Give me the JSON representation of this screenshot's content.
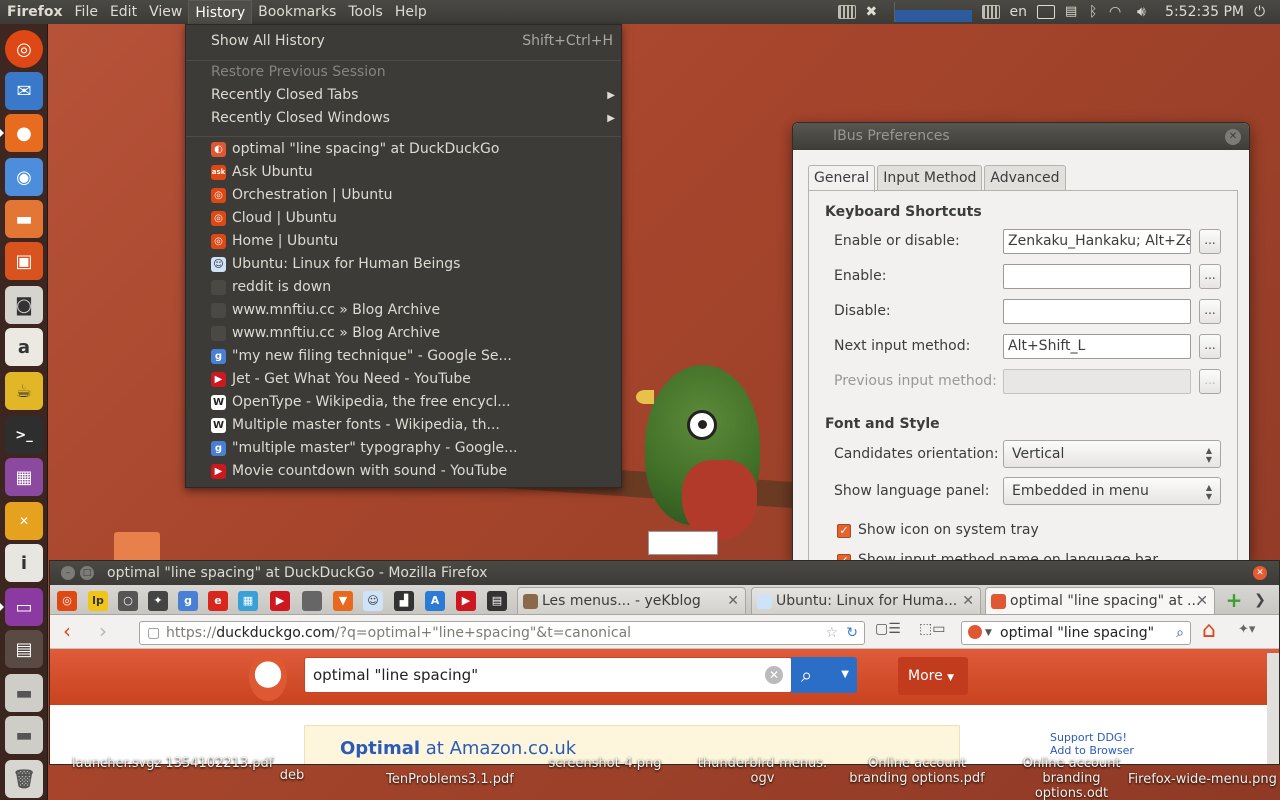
{
  "top_panel": {
    "app_name": "Firefox",
    "menus": [
      "File",
      "Edit",
      "View",
      "History",
      "Bookmarks",
      "Tools",
      "Help"
    ],
    "open_menu": "History",
    "tray": {
      "keyboard_layout": "en",
      "clock": "5:52:35 PM"
    }
  },
  "launcher": {
    "items": [
      "ubuntu-icon",
      "thunderbird-icon",
      "firefox-icon",
      "chromium-icon",
      "files-icon",
      "software-center-icon",
      "camera-icon",
      "font-icon",
      "teapot-icon",
      "terminal-icon",
      "video-editor-icon",
      "chat-icon",
      "info-icon",
      "monitor-icon",
      "window-icon",
      "drive-icon",
      "drive-icon-2",
      "trash-icon"
    ]
  },
  "history_menu": {
    "show_all": "Show All History",
    "show_all_accel": "Shift+Ctrl+H",
    "restore_session": "Restore Previous Session",
    "recently_closed_tabs": "Recently Closed Tabs",
    "recently_closed_windows": "Recently Closed Windows",
    "entries": [
      {
        "label": "optimal \"line spacing\" at DuckDuckGo",
        "icon": "duckduckgo-icon",
        "color": "#de5833"
      },
      {
        "label": "Ask Ubuntu",
        "icon": "askubuntu-icon",
        "color": "#dd4814"
      },
      {
        "label": "Orchestration | Ubuntu",
        "icon": "ubuntu-icon",
        "color": "#dd4814"
      },
      {
        "label": "Cloud | Ubuntu",
        "icon": "ubuntu-icon",
        "color": "#dd4814"
      },
      {
        "label": "Home | Ubuntu",
        "icon": "ubuntu-icon",
        "color": "#dd4814"
      },
      {
        "label": "Ubuntu: Linux for Human Beings",
        "icon": "reddit-icon",
        "color": "#cee3f8"
      },
      {
        "label": "reddit is down",
        "icon": "blank-page-icon",
        "color": "#4a4944"
      },
      {
        "label": "www.mnftiu.cc » Blog Archive",
        "icon": "blank-page-icon",
        "color": "#4a4944"
      },
      {
        "label": "www.mnftiu.cc » Blog Archive",
        "icon": "blank-page-icon",
        "color": "#4a4944"
      },
      {
        "label": "\"my new filing technique\" - Google Se...",
        "icon": "google-icon",
        "color": "#4a7fd6"
      },
      {
        "label": "Jet - Get What You Need - YouTube",
        "icon": "youtube-icon",
        "color": "#cc181e"
      },
      {
        "label": "OpenType - Wikipedia, the free encycl...",
        "icon": "wikipedia-icon",
        "color": "#ffffff"
      },
      {
        "label": "Multiple master fonts - Wikipedia, th...",
        "icon": "wikipedia-icon",
        "color": "#ffffff"
      },
      {
        "label": "\"multiple master\" typography - Google...",
        "icon": "google-icon",
        "color": "#4a7fd6"
      },
      {
        "label": "Movie countdown with sound - YouTube",
        "icon": "youtube-icon",
        "color": "#cc181e"
      }
    ]
  },
  "ibus": {
    "title": "IBus Preferences",
    "tabs": [
      "General",
      "Input Method",
      "Advanced"
    ],
    "keyboard_shortcuts_heading": "Keyboard Shortcuts",
    "enable_disable_label": "Enable or disable:",
    "enable_disable_value": "Zenkaku_Hankaku; Alt+Zenk",
    "enable_label": "Enable:",
    "enable_value": "",
    "disable_label": "Disable:",
    "disable_value": "",
    "next_label": "Next input method:",
    "next_value": "Alt+Shift_L",
    "prev_label": "Previous input method:",
    "prev_value": "",
    "dots": "...",
    "font_style_heading": "Font and Style",
    "orientation_label": "Candidates orientation:",
    "orientation_value": "Vertical",
    "lang_panel_label": "Show language panel:",
    "lang_panel_value": "Embedded in menu",
    "tray_checkbox_label": "Show icon on system tray",
    "next_checkbox_label": "Show input method name on language bar"
  },
  "firefox": {
    "title": "optimal \"line spacing\" at DuckDuckGo - Mozilla Firefox",
    "tabs": [
      {
        "label": "Les menus... - yeKblog",
        "active": false
      },
      {
        "label": "Ubuntu: Linux for Huma...",
        "active": false
      },
      {
        "label": "optimal \"line spacing\" at ...",
        "active": true
      }
    ],
    "url_prefix": "https://",
    "url_domain": "duckduckgo.com",
    "url_rest": "/?q=optimal+\"line+spacing\"&t=canonical",
    "search_value": "optimal \"line spacing\"",
    "ddg_query": "optimal \"line spacing\"",
    "more_label": "More",
    "ad_link_bold": "Optimal",
    "ad_link_rest": " at Amazon.co.uk",
    "support_text": "Support DDG!",
    "add_to_browser": "Add to Browser"
  },
  "desktop": {
    "labels": [
      {
        "text": "launcher.svgz 1354102213.pdf"
      },
      {
        "text": "deb"
      },
      {
        "text": "TenProblems3.1.pdf"
      },
      {
        "text": "screenshot-4.png"
      },
      {
        "text": "thunderbird-menus. ogv"
      },
      {
        "text": "Online account branding options.pdf"
      },
      {
        "text": "Online account branding options.odt"
      },
      {
        "text": "Firefox-wide-menu.png"
      }
    ]
  }
}
